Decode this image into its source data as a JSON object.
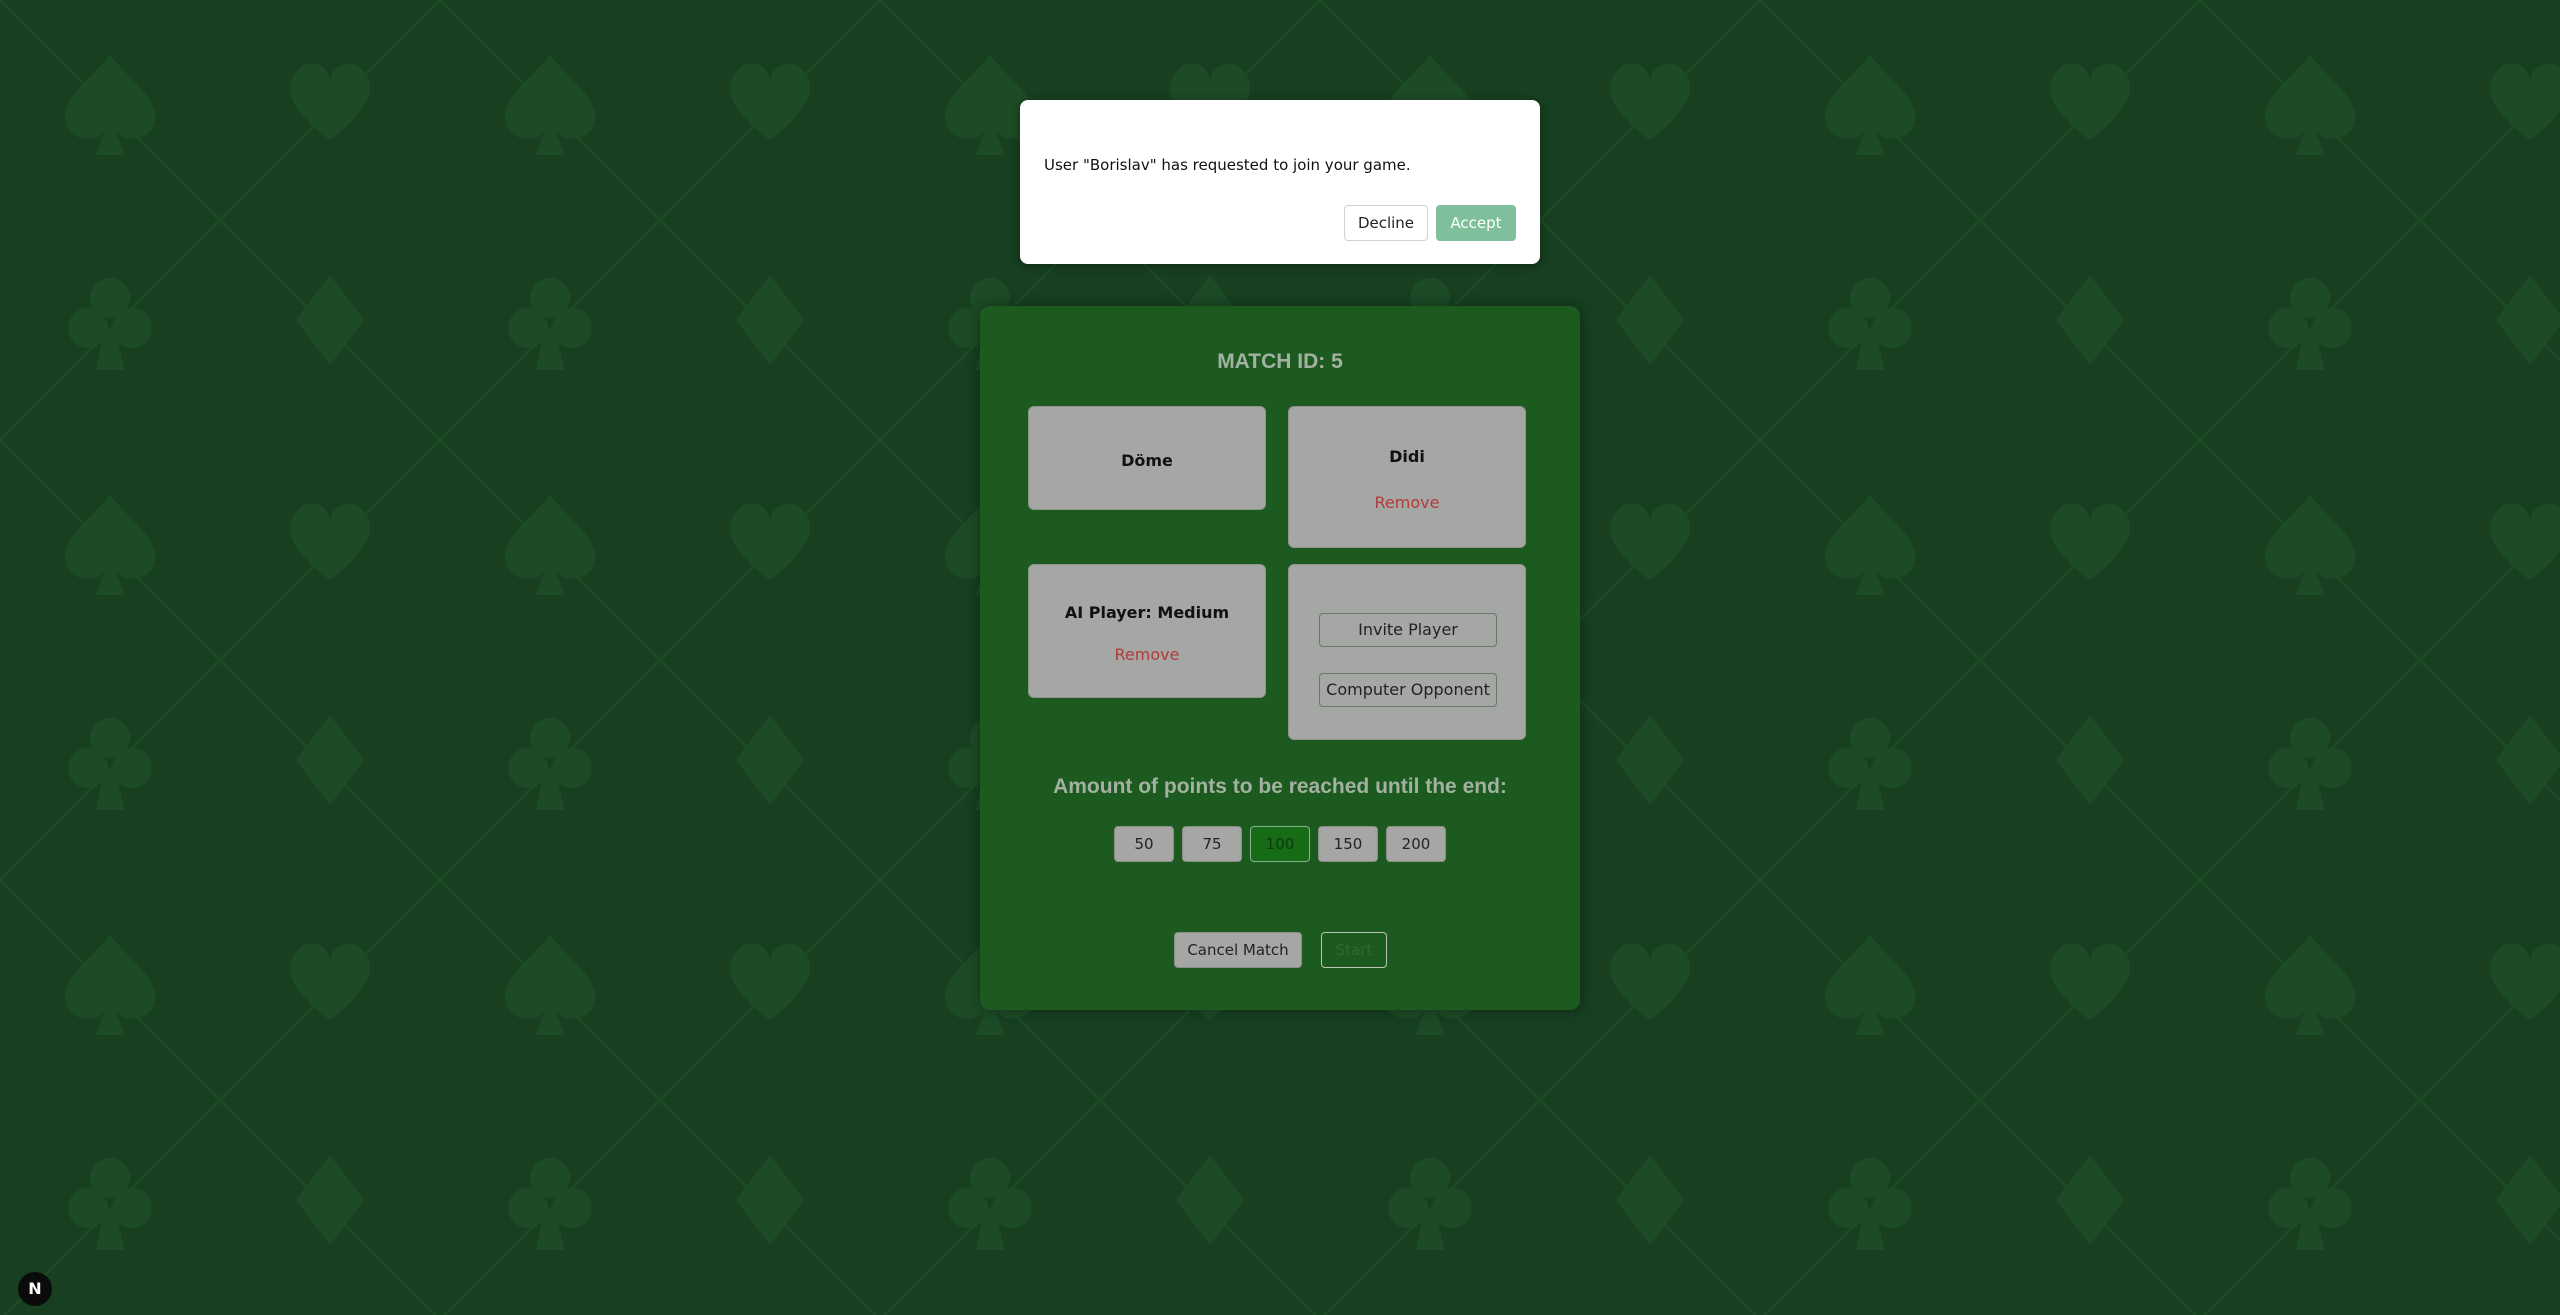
{
  "colors": {
    "background": "#173f20",
    "panel": "#1d5a1f",
    "slot": "#a5a7a5",
    "remove_text": "#b33a3a",
    "selected_points": "#166b16",
    "accept": "#7fbf9c"
  },
  "dialog": {
    "message": "User \"Borislav\" has requested to join your game.",
    "decline_label": "Decline",
    "accept_label": "Accept"
  },
  "match": {
    "title": "MATCH ID: 5",
    "slots": [
      {
        "name": "Döme"
      },
      {
        "name": "Didi",
        "remove_label": "Remove"
      },
      {
        "name": "AI Player: Medium",
        "remove_label": "Remove"
      },
      {
        "invite_label": "Invite Player",
        "computer_label": "Computer Opponent"
      }
    ],
    "points_label": "Amount of points to be reached until the end:",
    "points_options": [
      "50",
      "75",
      "100",
      "150",
      "200"
    ],
    "selected_points": "100",
    "cancel_label": "Cancel Match",
    "start_label": "Start"
  },
  "dev_badge": {
    "label": "N",
    "icon": "nextjs-icon"
  },
  "background_pattern": {
    "icons": [
      "spade-icon",
      "heart-icon",
      "club-icon",
      "diamond-icon"
    ]
  }
}
